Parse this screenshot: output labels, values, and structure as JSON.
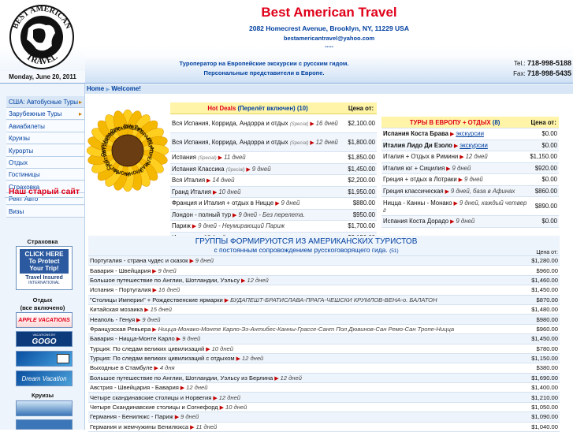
{
  "header": {
    "date": "Monday, June 20, 2011",
    "title": "Best American Travel",
    "address": "2082 Homecrest Avenue, Brooklyn, NY, 11229 USA",
    "email": "bestamericantravel@yahoo.com",
    "dots": ".....",
    "tagline1": "Туроператор на Европейские экскурсии с русским гидом.",
    "tagline2": "Персональные представители в Европе.",
    "tel_label": "Tel.:",
    "tel": "718-998-5188",
    "fax_label": "Fax:",
    "fax": "718-998-5435",
    "logo_text": "BEST AMERICAN TRAVEL"
  },
  "breadcrumb": {
    "home": "Home",
    "current": "Welcome!"
  },
  "sidebar": {
    "items": [
      {
        "label": "США: Автобусные Туры"
      },
      {
        "label": "Зарубежные Туры"
      },
      {
        "label": "Авиабилеты"
      },
      {
        "label": "Круизы"
      },
      {
        "label": "Курорты"
      },
      {
        "label": "Отдых"
      },
      {
        "label": "Гостиницы"
      },
      {
        "label": "Страховка"
      },
      {
        "label": "Рент Авто"
      },
      {
        "label": "Визы"
      }
    ],
    "old_site": "Наш старый сайт",
    "insurance_head": "Страховка",
    "insurance_banner": {
      "line1": "CLICK HERE",
      "line2": "To Protect",
      "line3": "Your Trip!",
      "brand": "Travel Insured",
      "brand2": "INTERNATIONAL"
    },
    "rest_head": "Отдых",
    "rest_sub": "(все включено)",
    "apple": "APPLE VACATIONS",
    "gogo": "GOGO",
    "gogo_top": "VACATIONS BY",
    "dream": "Dream Vacation",
    "cruise_head": "Круизы"
  },
  "months": [
    "ЯНВАРЬ",
    "ФЕВРАЛЬ",
    "МАРТ",
    "АПРЕЛЬ",
    "МАЙ",
    "ИЮНЬ",
    "ИЮЛЬ",
    "АВГУСТ",
    "СЕНТЯБРЬ",
    "ОКТЯБРЬ",
    "НОЯБРЬ",
    "ДЕКАБРЬ"
  ],
  "hot": {
    "title": "Hot Deals",
    "subtitle": "(Перелёт включен)",
    "count": "(10)",
    "price_head": "Цена от:",
    "rows": [
      {
        "name": "Вся Испания, Коррида, Андорра и отдых",
        "spec": "(Special)",
        "days": "16 дней",
        "price": "$2,100.00"
      },
      {
        "name": "Вся Испания, Коррида, Андорра и отдых",
        "spec": "(Special)",
        "days": "12 дней",
        "price": "$1,800.00"
      },
      {
        "name": "Испания",
        "spec": "(Special)",
        "days": "11 дней",
        "price": "$1,850.00"
      },
      {
        "name": "Испания Классика",
        "spec": "(Special)",
        "days": "9 дней",
        "price": "$1,450.00"
      },
      {
        "name": "Вся Италия",
        "spec": "",
        "days": "14 дней",
        "price": "$2,200.00"
      },
      {
        "name": "Гранд Италия",
        "spec": "",
        "days": "10 дней",
        "price": "$1,950.00"
      },
      {
        "name": "Франция и Италия + отдых в Ницце",
        "spec": "",
        "days": "9 дней",
        "price": "$880.00"
      },
      {
        "name": "Лондон - полный тур",
        "spec": "",
        "days": "9 дней - Без перелета.",
        "price": "$950.00"
      },
      {
        "name": "Париж",
        "spec": "",
        "days": "9 дней - Неумирающий Париж",
        "price": "$1,700.00"
      },
      {
        "name": "Израиль",
        "spec": "",
        "days": "13 дней",
        "price": "$2,150.00"
      }
    ]
  },
  "europe": {
    "title": "ТУРЫ В ЕВРОПУ + ОТДЫХ",
    "count": "(8)",
    "price_head": "Цена от:",
    "rows": [
      {
        "name": "Испания Коста Брава",
        "days": "экскурсии",
        "price": "$0.00",
        "link": true
      },
      {
        "name": "Италия Лидо Ди Езоло",
        "days": "экскурсии",
        "price": "$0.00",
        "link": true
      },
      {
        "name": "Италия + Отдых в Римини",
        "days": "12 дней",
        "price": "$1,150.00"
      },
      {
        "name": "Италия юг + Сицилия",
        "days": "9 дней",
        "price": "$920.00"
      },
      {
        "name": "Греция + отдых в Лотраки",
        "days": "9 дней",
        "price": "$0.00"
      },
      {
        "name": "Греция классическая",
        "days": "9 дней, база в Афинах",
        "price": "$860.00"
      },
      {
        "name": "Ницца - Канны - Монако",
        "days": "9 дней, каждый четвер г",
        "price": "$890.00"
      },
      {
        "name": "Испания Коста Дорадо",
        "days": "9 дней",
        "price": "$0.00"
      }
    ]
  },
  "groups": {
    "title": "ГРУППЫ ФОРМИРУЮТСЯ ИЗ АМЕРИКАНСКИХ ТУРИСТОВ",
    "subtitle": "с постоянным сопровождением русскоговорящего гида.",
    "count": "(51)",
    "price_head": "Цена от:",
    "rows": [
      {
        "name": "Португалия - страна чудес и сказок",
        "days": "9 дней",
        "price": "$1,280.00"
      },
      {
        "name": "Бавария - Швейцария",
        "days": "9 дней",
        "price": "$960.00"
      },
      {
        "name": "Большое путешествие по Англии, Шотландии, Уэльсу",
        "days": "12 дней",
        "price": "$1,460.00"
      },
      {
        "name": "Испания - Португалия",
        "days": "16 дней",
        "price": "$1,450.00"
      },
      {
        "name": "\"Столицы Империи\" + Рождественские ярмарки",
        "days": "БУДАПЕШТ-БРАТИСЛАВА-ПРАГА-ЧЕШСКИ КРУМЛОВ-ВЕНА-о. БАЛАТОН",
        "price": "$870.00"
      },
      {
        "name": "Китайская мозаика",
        "days": "15 дней",
        "price": "$1,480.00"
      },
      {
        "name": "Неаполь - Генуя",
        "days": "9 дней",
        "price": "$980.00"
      },
      {
        "name": "Французская Ревьера",
        "days": "Ницца-Монако-Монте Карло-Эз-Антибес-Канны-Грассе-Сант Пол Дювинов-Сан Ремо-Сан Тропе-Ницца",
        "price": "$960.00"
      },
      {
        "name": "Бавария - Ницца-Монте Карло",
        "days": "9 дней",
        "price": "$1,450.00"
      },
      {
        "name": "Турция: По следам великих цивилизаций",
        "days": "10 дней",
        "price": "$780.00"
      },
      {
        "name": "Турция: По следам великих цивилизаций с отдыхом",
        "days": "12 дней",
        "price": "$1,150.00"
      },
      {
        "name": "Выходные в Стамбуле",
        "days": "4 дня",
        "price": "$380.00"
      },
      {
        "name": "Большое путешествие по Англии, Шотландии, Уэльсу из Берлина",
        "days": "12 дней",
        "price": "$1,690.00"
      },
      {
        "name": "Австрия - Швейцария - Бавария",
        "days": "12 дней",
        "price": "$1,400.00"
      },
      {
        "name": "Четыре скандинавские столицы и Норвегия",
        "days": "12 дней",
        "price": "$1,210.00"
      },
      {
        "name": "Четыре Скандинавские столицы и Согнефорд",
        "days": "10 дней",
        "price": "$1,050.00"
      },
      {
        "name": "Германия - Бенилюкс - Париж",
        "days": "9 дней",
        "price": "$1,090.00"
      },
      {
        "name": "Германия и жемчужины Бенилюкса",
        "days": "11 дней",
        "price": "$1,040.00"
      }
    ]
  }
}
